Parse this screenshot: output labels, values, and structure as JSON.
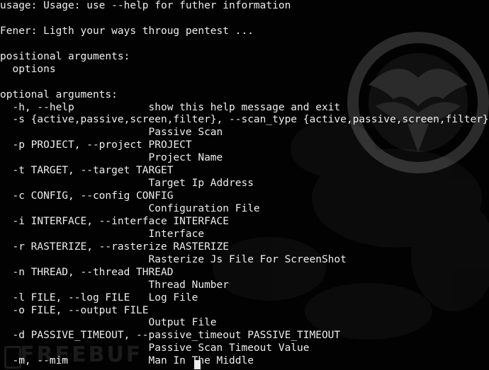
{
  "terminal": {
    "lines": [
      "usage: Usage: use --help for futher information",
      "",
      "Fener: Ligth your ways throug pentest ...",
      "",
      "positional arguments:",
      "  options",
      "",
      "optional arguments:",
      "  -h, --help            show this help message and exit",
      "  -s {active,passive,screen,filter}, --scan_type {active,passive,screen,filter}",
      "                        Passive Scan",
      "  -p PROJECT, --project PROJECT",
      "                        Project Name",
      "  -t TARGET, --target TARGET",
      "                        Target Ip Address",
      "  -c CONFIG, --config CONFIG",
      "                        Configuration File",
      "  -i INTERFACE, --interface INTERFACE",
      "                        Interface",
      "  -r RASTERIZE, --rasterize RASTERIZE",
      "                        Rasterize Js File For ScreenShot",
      "  -n THREAD, --thread THREAD",
      "                        Thread Number",
      "  -l FILE, --log FILE   Log File",
      "  -o FILE, --output FILE",
      "                        Output File",
      "  -d PASSIVE_TIMEOUT, --passive_timeout PASSIVE_TIMEOUT",
      "                        Passive Scan Timeout Value",
      "  -m, --mim             Man In The Middle"
    ]
  },
  "watermark": {
    "text": "FREEBUF"
  },
  "colors": {
    "background": "#020202",
    "foreground": "#ededed"
  }
}
